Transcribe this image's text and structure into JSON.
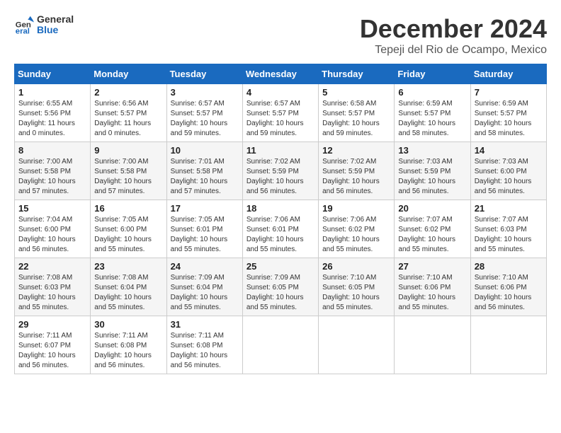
{
  "header": {
    "logo": {
      "general": "General",
      "blue": "Blue"
    },
    "title": "December 2024",
    "location": "Tepeji del Rio de Ocampo, Mexico"
  },
  "calendar": {
    "weekdays": [
      "Sunday",
      "Monday",
      "Tuesday",
      "Wednesday",
      "Thursday",
      "Friday",
      "Saturday"
    ],
    "weeks": [
      [
        {
          "day": "1",
          "sunrise": "6:55 AM",
          "sunset": "5:56 PM",
          "daylight": "11 hours and 0 minutes."
        },
        {
          "day": "2",
          "sunrise": "6:56 AM",
          "sunset": "5:57 PM",
          "daylight": "11 hours and 0 minutes."
        },
        {
          "day": "3",
          "sunrise": "6:57 AM",
          "sunset": "5:57 PM",
          "daylight": "10 hours and 59 minutes."
        },
        {
          "day": "4",
          "sunrise": "6:57 AM",
          "sunset": "5:57 PM",
          "daylight": "10 hours and 59 minutes."
        },
        {
          "day": "5",
          "sunrise": "6:58 AM",
          "sunset": "5:57 PM",
          "daylight": "10 hours and 59 minutes."
        },
        {
          "day": "6",
          "sunrise": "6:59 AM",
          "sunset": "5:57 PM",
          "daylight": "10 hours and 58 minutes."
        },
        {
          "day": "7",
          "sunrise": "6:59 AM",
          "sunset": "5:57 PM",
          "daylight": "10 hours and 58 minutes."
        }
      ],
      [
        {
          "day": "8",
          "sunrise": "7:00 AM",
          "sunset": "5:58 PM",
          "daylight": "10 hours and 57 minutes."
        },
        {
          "day": "9",
          "sunrise": "7:00 AM",
          "sunset": "5:58 PM",
          "daylight": "10 hours and 57 minutes."
        },
        {
          "day": "10",
          "sunrise": "7:01 AM",
          "sunset": "5:58 PM",
          "daylight": "10 hours and 57 minutes."
        },
        {
          "day": "11",
          "sunrise": "7:02 AM",
          "sunset": "5:59 PM",
          "daylight": "10 hours and 56 minutes."
        },
        {
          "day": "12",
          "sunrise": "7:02 AM",
          "sunset": "5:59 PM",
          "daylight": "10 hours and 56 minutes."
        },
        {
          "day": "13",
          "sunrise": "7:03 AM",
          "sunset": "5:59 PM",
          "daylight": "10 hours and 56 minutes."
        },
        {
          "day": "14",
          "sunrise": "7:03 AM",
          "sunset": "6:00 PM",
          "daylight": "10 hours and 56 minutes."
        }
      ],
      [
        {
          "day": "15",
          "sunrise": "7:04 AM",
          "sunset": "6:00 PM",
          "daylight": "10 hours and 56 minutes."
        },
        {
          "day": "16",
          "sunrise": "7:05 AM",
          "sunset": "6:00 PM",
          "daylight": "10 hours and 55 minutes."
        },
        {
          "day": "17",
          "sunrise": "7:05 AM",
          "sunset": "6:01 PM",
          "daylight": "10 hours and 55 minutes."
        },
        {
          "day": "18",
          "sunrise": "7:06 AM",
          "sunset": "6:01 PM",
          "daylight": "10 hours and 55 minutes."
        },
        {
          "day": "19",
          "sunrise": "7:06 AM",
          "sunset": "6:02 PM",
          "daylight": "10 hours and 55 minutes."
        },
        {
          "day": "20",
          "sunrise": "7:07 AM",
          "sunset": "6:02 PM",
          "daylight": "10 hours and 55 minutes."
        },
        {
          "day": "21",
          "sunrise": "7:07 AM",
          "sunset": "6:03 PM",
          "daylight": "10 hours and 55 minutes."
        }
      ],
      [
        {
          "day": "22",
          "sunrise": "7:08 AM",
          "sunset": "6:03 PM",
          "daylight": "10 hours and 55 minutes."
        },
        {
          "day": "23",
          "sunrise": "7:08 AM",
          "sunset": "6:04 PM",
          "daylight": "10 hours and 55 minutes."
        },
        {
          "day": "24",
          "sunrise": "7:09 AM",
          "sunset": "6:04 PM",
          "daylight": "10 hours and 55 minutes."
        },
        {
          "day": "25",
          "sunrise": "7:09 AM",
          "sunset": "6:05 PM",
          "daylight": "10 hours and 55 minutes."
        },
        {
          "day": "26",
          "sunrise": "7:10 AM",
          "sunset": "6:05 PM",
          "daylight": "10 hours and 55 minutes."
        },
        {
          "day": "27",
          "sunrise": "7:10 AM",
          "sunset": "6:06 PM",
          "daylight": "10 hours and 55 minutes."
        },
        {
          "day": "28",
          "sunrise": "7:10 AM",
          "sunset": "6:06 PM",
          "daylight": "10 hours and 56 minutes."
        }
      ],
      [
        {
          "day": "29",
          "sunrise": "7:11 AM",
          "sunset": "6:07 PM",
          "daylight": "10 hours and 56 minutes."
        },
        {
          "day": "30",
          "sunrise": "7:11 AM",
          "sunset": "6:08 PM",
          "daylight": "10 hours and 56 minutes."
        },
        {
          "day": "31",
          "sunrise": "7:11 AM",
          "sunset": "6:08 PM",
          "daylight": "10 hours and 56 minutes."
        },
        null,
        null,
        null,
        null
      ]
    ],
    "labels": {
      "sunrise": "Sunrise:",
      "sunset": "Sunset:",
      "daylight": "Daylight:"
    }
  }
}
